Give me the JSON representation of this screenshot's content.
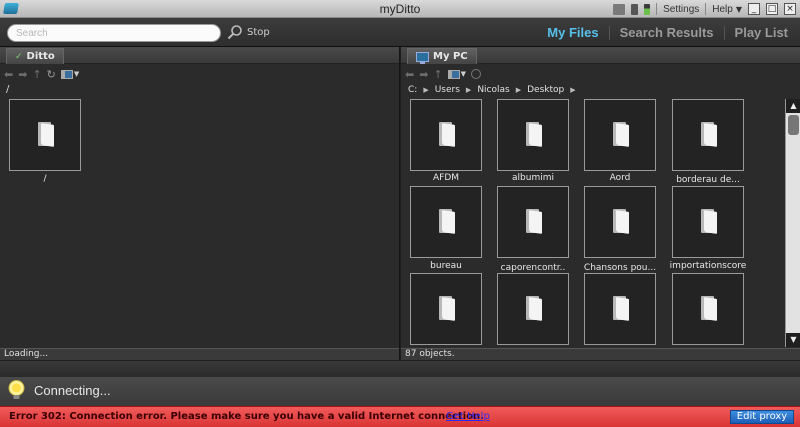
{
  "window": {
    "title": "myDitto",
    "settings_label": "Settings",
    "help_label": "Help",
    "minimize": "_",
    "maximize": "□",
    "close": "×"
  },
  "toolbar": {
    "search_placeholder": "Search",
    "stop_label": "Stop",
    "tabs": [
      "My Files",
      "Search Results",
      "Play List"
    ],
    "active_tab": "My Files",
    "accent_color": "#56c0ea"
  },
  "left_panel": {
    "tab_label": "Ditto",
    "path": "/",
    "items": [
      {
        "label": "/",
        "icon": "folder-icon"
      }
    ],
    "status": "Loading..."
  },
  "right_panel": {
    "tab_label": "My PC",
    "breadcrumb": [
      "C:",
      "Users",
      "Nicolas",
      "Desktop"
    ],
    "items": [
      {
        "label": "AFDM"
      },
      {
        "label": "albumimi"
      },
      {
        "label": "Aord"
      },
      {
        "label": "borderau de..."
      },
      {
        "label": "bureau"
      },
      {
        "label": "caporencontr.."
      },
      {
        "label": "Chansons pou..."
      },
      {
        "label": "importationscore"
      },
      {
        "label": ""
      },
      {
        "label": ""
      },
      {
        "label": ""
      },
      {
        "label": ""
      }
    ],
    "status": "87 objects."
  },
  "connection": {
    "text": "Connecting..."
  },
  "error": {
    "message": "Error 302: Connection error. Please make sure you have a valid Internet connection.",
    "link": "Get Help",
    "button": "Edit proxy",
    "color": "#e24444"
  }
}
